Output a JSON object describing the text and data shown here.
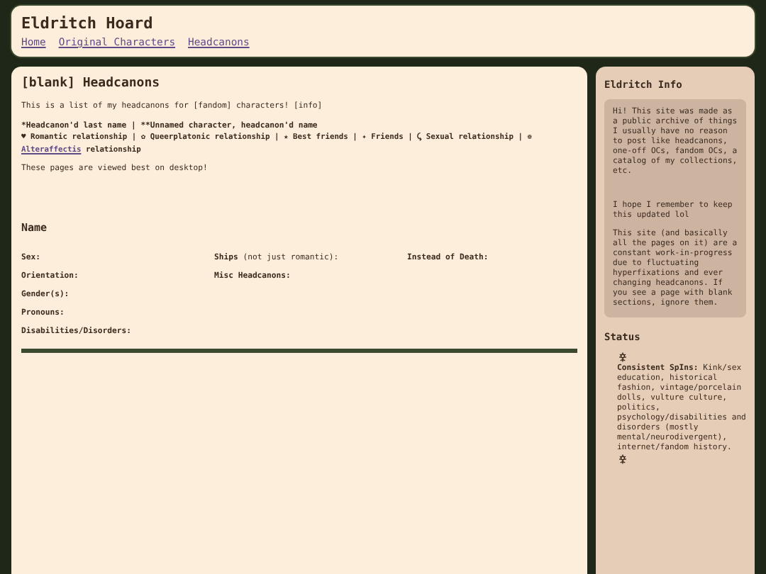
{
  "header": {
    "title": "Eldritch Hoard",
    "nav": [
      "Home",
      "Original Characters",
      "Headcanons"
    ]
  },
  "main": {
    "title": "[blank] Headcanons",
    "intro": "This is a list of my headcanons for [fandom] characters! [info]",
    "key_line": "*Headcanon'd last name | **Unnamed character, headcanon'd name",
    "legend": {
      "before": "♥ Romantic relationship | ✿ Queerplatonic relationship | ★ Best friends | ✦ Friends | ⤹ Sexual relationship | ❁",
      "link": "Alteraffectis",
      "after": "relationship"
    },
    "note": "These pages are viewed best on desktop!",
    "character": {
      "name": "Name",
      "columns": [
        [
          {
            "label": "Sex:"
          },
          {
            "label": "Orientation:"
          },
          {
            "label": "Gender(s):"
          },
          {
            "label": "Pronouns:"
          },
          {
            "label": "Disabilities/Disorders:"
          }
        ],
        [
          {
            "label": "Ships",
            "note": "(not just romantic):"
          },
          {
            "label": "Misc Headcanons:"
          }
        ],
        [
          {
            "label": "Instead of Death:"
          }
        ]
      ]
    }
  },
  "sidebar": {
    "info_title": "Eldritch Info",
    "info_paragraphs": [
      "Hi! This site was made as a public archive of things I usually have no reason to post like headcanons, one-off OCs, fandom OCs, a catalog of my collections, etc.",
      "I hope I remember to keep this updated lol",
      "This site (and basically all the pages on it) are a constant work-in-progress due to fluctuating hyperfixations and ever changing headcanons. If you see a page with blank sections, ignore them."
    ],
    "status_title": "Status",
    "status_label": "Consistent SpIns:",
    "status_text": "Kink/sex education, historical fashion, vintage/porcelain dolls, vulture culture, politics, psychology/disabilities and disorders (mostly mental/neurodivergent), internet/fandom history."
  }
}
